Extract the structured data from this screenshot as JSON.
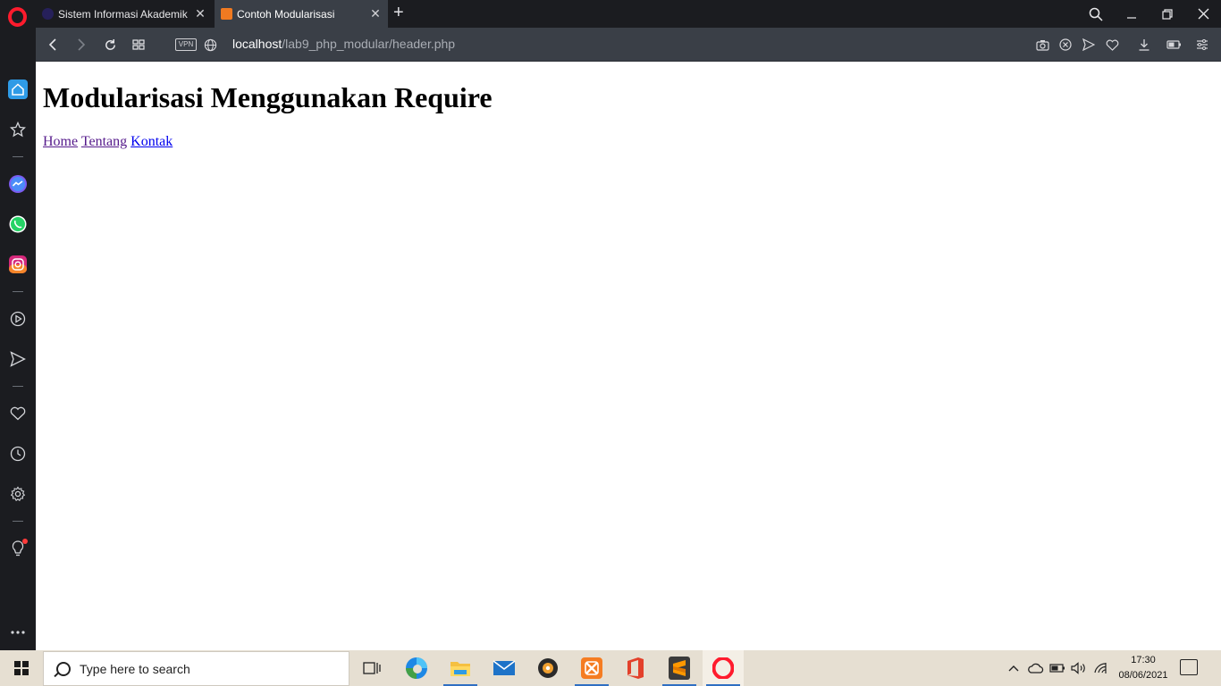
{
  "tabs": [
    {
      "title": "Sistem Informasi Akademik",
      "close": "✕",
      "active": false
    },
    {
      "title": "Contoh Modularisasi",
      "close": "✕",
      "active": true
    }
  ],
  "new_tab": "+",
  "window_controls": {
    "search": "⌕",
    "minimize": "—",
    "restore": "❐",
    "close": "✕"
  },
  "toolbar": {
    "vpn_label": "VPN",
    "url_host": "localhost",
    "url_path": "/lab9_php_modular/header.php"
  },
  "page": {
    "heading": "Modularisasi Menggunakan Require",
    "nav": [
      {
        "label": "Home",
        "visited": true
      },
      {
        "label": "Tentang",
        "visited": true
      },
      {
        "label": "Kontak",
        "visited": false
      }
    ]
  },
  "taskbar": {
    "search_placeholder": "Type here to search",
    "time": "17:30",
    "date": "08/06/2021"
  },
  "colors": {
    "tabbar_bg": "#1b1c20",
    "toolbar_bg": "#3a3f47",
    "opera_red": "#ff1b2d",
    "taskbar_bg": "#e6dfd2",
    "link_visited": "#551a8b",
    "link_unvisited": "#0000ee"
  }
}
